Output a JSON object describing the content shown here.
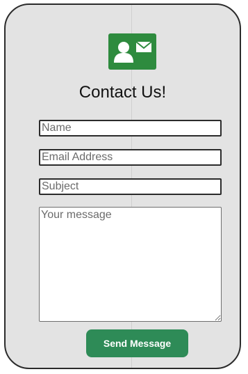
{
  "form": {
    "title": "Contact Us!",
    "name_placeholder": "Name",
    "email_placeholder": "Email Address",
    "subject_placeholder": "Subject",
    "message_placeholder": "Your message",
    "send_label": "Send Message"
  },
  "icons": {
    "logo": "contact-card-icon"
  },
  "colors": {
    "accent": "#2e8b57",
    "logo_bg": "#2e8b3e",
    "card_bg": "#e3e3e3",
    "border": "#2b2b2b"
  }
}
